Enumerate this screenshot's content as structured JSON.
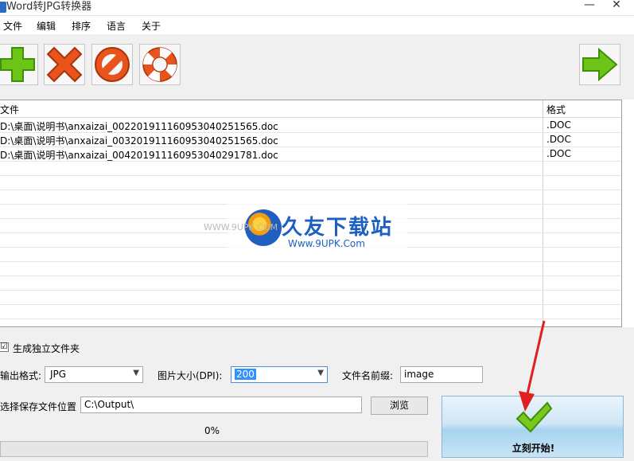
{
  "window": {
    "title": "Word转JPG转换器",
    "minimize": "—",
    "close": "✕"
  },
  "menu": [
    "文件",
    "编辑",
    "排序",
    "语言",
    "关于"
  ],
  "toolbar": {
    "icons": [
      "add-icon",
      "delete-icon",
      "clear-icon",
      "help-icon",
      "next-icon"
    ],
    "colors": {
      "add": "#6cc416",
      "delete": "#e8541c",
      "clear": "#e8541c",
      "next": "#6cc416"
    }
  },
  "table": {
    "headers": {
      "file": "文件",
      "format": "格式"
    },
    "rows": [
      {
        "path": "D:\\桌面\\说明书\\anxaizai_00220191116095304025156​5.doc",
        "format": ".DOC"
      },
      {
        "path": "D:\\桌面\\说明书\\anxaizai_00320191116095304025156​5.doc",
        "format": ".DOC"
      },
      {
        "path": "D:\\桌面\\说明书\\anxaizai_00420191116095304029178​1.doc",
        "format": ".DOC"
      }
    ]
  },
  "watermark": {
    "cn": "久友下载站",
    "url": "Www.9UPK.Com",
    "left": "WWW.9UPK.COM"
  },
  "options": {
    "separate_folder_label": "生成独立文件夹",
    "separate_folder_checked": "☑",
    "format_label": "输出格式:",
    "format_value": "JPG",
    "dpi_label": "图片大小(DPI):",
    "dpi_value": "200",
    "prefix_label": "文件名前缀:",
    "prefix_value": "image",
    "save_label": "选择保存文件位置",
    "save_path": "C:\\Output\\",
    "browse": "浏览",
    "progress_text": "0%",
    "progress_value": 0,
    "start": "立刻开始!"
  }
}
